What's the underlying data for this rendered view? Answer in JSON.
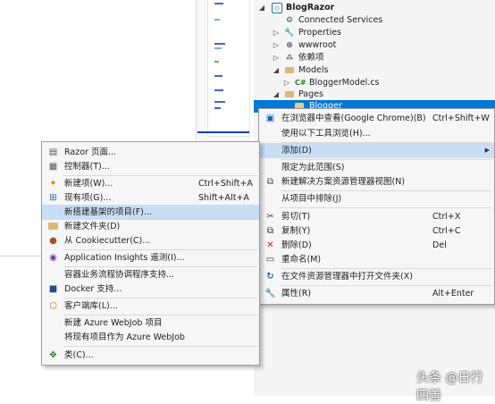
{
  "solution_tree": [
    {
      "label": "BlogRazor",
      "icon": "project-icon",
      "bold": true
    },
    {
      "label": "Connected Services",
      "icon": "connected-services-icon"
    },
    {
      "label": "Properties",
      "icon": "wrench-icon"
    },
    {
      "label": "wwwroot",
      "icon": "globe-icon"
    },
    {
      "label": "依赖项",
      "icon": "dependencies-icon"
    },
    {
      "label": "Models",
      "icon": "folder-icon"
    },
    {
      "label": "BloggerModel.cs",
      "icon": "csharp-file-icon"
    },
    {
      "label": "Pages",
      "icon": "folder-icon"
    },
    {
      "label": "Blogger",
      "icon": "folder-icon"
    }
  ],
  "context_menu": {
    "items": [
      {
        "label": "在浏览器中查看(Google Chrome)(B)",
        "shortcut": "Ctrl+Shift+W",
        "icon": "browser-icon"
      },
      {
        "label": "使用以下工具浏览(H)...",
        "shortcut": "",
        "icon": ""
      },
      {
        "label": "添加(D)",
        "shortcut": "",
        "icon": "",
        "submenu": true
      },
      {
        "label": "限定为此范围(S)",
        "shortcut": "",
        "icon": ""
      },
      {
        "label": "新建解决方案资源管理器视图(N)",
        "shortcut": "",
        "icon": "new-view-icon"
      },
      {
        "label": "从项目中排除(J)",
        "shortcut": "",
        "icon": ""
      },
      {
        "label": "剪切(T)",
        "shortcut": "Ctrl+X",
        "icon": "scissors-icon"
      },
      {
        "label": "复制(Y)",
        "shortcut": "Ctrl+C",
        "icon": "copy-icon"
      },
      {
        "label": "删除(D)",
        "shortcut": "Del",
        "icon": "delete-icon"
      },
      {
        "label": "重命名(M)",
        "shortcut": "",
        "icon": "rename-icon"
      },
      {
        "label": "在文件资源管理器中打开文件夹(X)",
        "shortcut": "",
        "icon": "refresh-icon"
      },
      {
        "label": "属性(R)",
        "shortcut": "Alt+Enter",
        "icon": "wrench-icon"
      }
    ]
  },
  "add_submenu": {
    "items": [
      {
        "label": "Razor 页面...",
        "shortcut": "",
        "icon": "razor-page-icon"
      },
      {
        "label": "控制器(T)...",
        "shortcut": "",
        "icon": "controller-icon"
      },
      {
        "label": "新建项(W)...",
        "shortcut": "Ctrl+Shift+A",
        "icon": "new-item-icon"
      },
      {
        "label": "现有项(G)...",
        "shortcut": "Shift+Alt+A",
        "icon": "existing-item-icon"
      },
      {
        "label": "新搭建基架的项目(F)...",
        "shortcut": "",
        "icon": ""
      },
      {
        "label": "新建文件夹(D)",
        "shortcut": "",
        "icon": "new-folder-icon"
      },
      {
        "label": "从 Cookiecutter(C)...",
        "shortcut": "",
        "icon": "cookiecutter-icon"
      },
      {
        "label": "Application Insights 遥测(I)...",
        "shortcut": "",
        "icon": "insights-icon"
      },
      {
        "label": "容器业务流程协调程序支持...",
        "shortcut": "",
        "icon": ""
      },
      {
        "label": "Docker 支持...",
        "shortcut": "",
        "icon": "docker-icon"
      },
      {
        "label": "客户端库(L)...",
        "shortcut": "",
        "icon": "client-library-icon"
      },
      {
        "label": "新建 Azure WebJob 项目",
        "shortcut": "",
        "icon": ""
      },
      {
        "label": "将现有项目作为 Azure WebJob",
        "shortcut": "",
        "icon": ""
      },
      {
        "label": "类(C)...",
        "shortcut": "",
        "icon": "class-icon"
      }
    ]
  },
  "watermark": "头条 @日行四善",
  "colors": {
    "selection": "#0078d7",
    "menu_highlight": "#c9def5",
    "menu_bg": "#f6f6f6"
  }
}
